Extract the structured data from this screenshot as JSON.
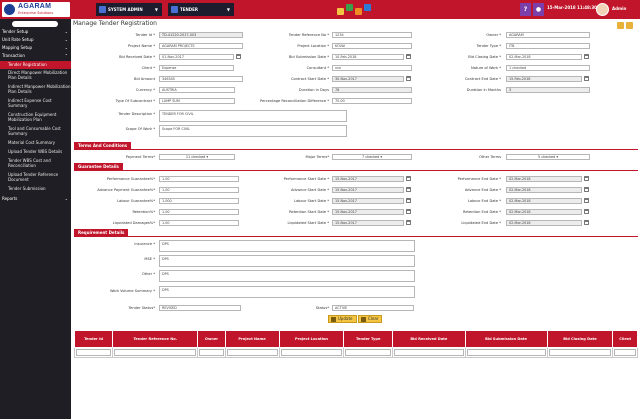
{
  "header": {
    "logo_title": "AGARAM",
    "logo_subtitle": "Enterprise Solutions",
    "module": "SYSTEM ADMIN",
    "submodule": "TENDER",
    "help_label": "?",
    "datetime": "15-Mar-2018 11:48:30",
    "user": "Admin",
    "colors": {
      "brand": "#c0152a",
      "dark": "#1e1e24",
      "accent": "#1c3f94"
    }
  },
  "sidebar": {
    "items": [
      {
        "label": "Tender Setup"
      },
      {
        "label": "Unit Rate Setup"
      },
      {
        "label": "Mapping Setup"
      },
      {
        "label": "Transaction"
      }
    ],
    "subitems": [
      "Tender Registration",
      "Direct Manpower Mobilization Plan Details",
      "Indirect Manpower Mobilization Plan Details",
      "Indirect Expense Cost Summary",
      "Construction Equipment Mobilization Plan",
      "Tool and Consumable Cost Summary",
      "Material Cost Summary",
      "Upload Tender WBS Details",
      "Tender WBS Cost and Reconciliation",
      "Upload Tender Reference Document",
      "Tender Submission"
    ],
    "reports": "Reports"
  },
  "page": {
    "title": "Manage Tender Registration"
  },
  "form": {
    "tender_no_label": "Tender Id *",
    "tender_no": "TD-41220-2017-003",
    "ref_label": "Tender Reference No *",
    "ref": "1234",
    "owner_label": "Owner *",
    "owner": "AGARAM",
    "pname_label": "Project Name *",
    "pname": "AGARAM PROJECTS",
    "ploc_label": "Project Location *",
    "ploc": "KOVAI",
    "ttype_label": "Tender Type *",
    "ttype": "ITB",
    "brd_label": "Bid Received Date *",
    "brd": "01-Nov-2017",
    "bsd_label": "Bid Submission Date *",
    "bsd": "10-Feb-2018",
    "bcd_label": "Bid Closing Date *",
    "bcd": "02-Mar-2018",
    "client_label": "Client *",
    "client": "Expense",
    "consultant_label": "Consultant *",
    "consultant": "vvn",
    "now_label": "Nature of Work *",
    "now": "1 checked",
    "bamt_label": "Bid Amount",
    "bamt": "346345",
    "csd_label": "Contract Start Date *",
    "csd": "30-Nov-2017",
    "ced_label": "Contract End Date *",
    "ced": "15-Feb-2018",
    "currency_label": "Currency *",
    "currency": "AUSTRIA",
    "did_label": "Duration in Days",
    "did": "78",
    "dim_label": "Duration in Months",
    "dim": "3",
    "tos_label": "Type Of Subcontract *",
    "tos": "LUMP SUM",
    "prd_label": "Percentage Reconciliation Difference *",
    "prd": "70.00",
    "tdesc_label": "Tender Description *",
    "tdesc": "TENDER FOR CIVIL",
    "sow_label": "Scope Of Work *",
    "sow": "Scope FOR CIVIL"
  },
  "terms": {
    "title": "Terms And Conditions",
    "payment_label": "Payment Terms*",
    "payment": "11 checked",
    "major_label": "Major Terms*",
    "major": "7 checked",
    "other_label": "Other Terms",
    "other": "5 checked"
  },
  "guarantee": {
    "title": "Guarantee Details",
    "rows": [
      {
        "name": "Performance Guarantee%*",
        "val": "1.00",
        "sd_label": "Performance Start Date *",
        "sd": "15-Nov-2017",
        "ed_label": "Performance End Date *",
        "ed": "02-Mar-2018"
      },
      {
        "name": "Advance Payment Guarantee%*",
        "val": "1.00",
        "sd_label": "Advance Start Date *",
        "sd": "15-Nov-2017",
        "ed_label": "Advance End Date *",
        "ed": "02-Mar-2018"
      },
      {
        "name": "Labour Guarantee%*",
        "val": "1.000",
        "sd_label": "Labour Start Date *",
        "sd": "15-Nov-2017",
        "ed_label": "Labour End Date *",
        "ed": "02-Mar-2018"
      },
      {
        "name": "Retention%*",
        "val": "1.00",
        "sd_label": "Retention Start Date *",
        "sd": "15-Nov-2017",
        "ed_label": "Retention End Date *",
        "ed": "02-Mar-2018"
      },
      {
        "name": "Liquidated Damages%*",
        "val": "1.00",
        "sd_label": "Liquidated Start Date *",
        "sd": "15-Nov-2017",
        "ed_label": "Liquidated End Date *",
        "ed": "02-Mar-2018"
      }
    ]
  },
  "requirement": {
    "title": "Requirement Details",
    "insurance_label": "Insurance *",
    "insurance": "DPS",
    "mse_label": "MSE *",
    "mse": "DPS",
    "other_label": "Other *",
    "other": "DPS",
    "wvs_label": "Work Volume Summary *",
    "wvs": "DPS",
    "tstatus_label": "Tender Status*",
    "tstatus": "REVISED",
    "status_label": "Status*",
    "status": "ACTIVE",
    "update_btn": "Update",
    "clear_btn": "Clear"
  },
  "grid": {
    "columns": [
      "Tender Id",
      "Tender Reference No.",
      "Owner",
      "Project Name",
      "Project Location",
      "Tender Type",
      "Bid Received Date",
      "Bid Submission Date",
      "Bid Closing Date",
      "Client"
    ]
  }
}
